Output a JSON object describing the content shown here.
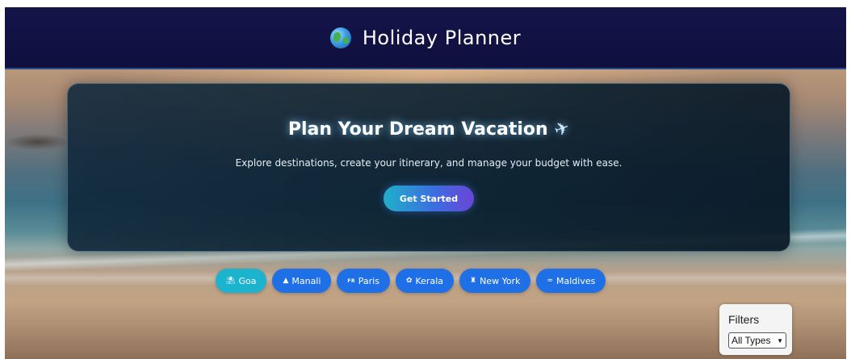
{
  "header": {
    "title": "Holiday Planner",
    "icon": "globe-icon"
  },
  "hero": {
    "title": "Plan Your Dream Vacation",
    "title_icon": "airplane-icon",
    "subtitle": "Explore destinations, create your itinerary, and manage your budget with ease.",
    "cta_label": "Get Started"
  },
  "destinations": [
    {
      "label": "Goa",
      "icon": "beach-umbrella-icon",
      "active": true
    },
    {
      "label": "Manali",
      "icon": "mountain-icon",
      "active": false
    },
    {
      "label": "Paris",
      "icon": "flag-fr-icon",
      "icon_text": "FR",
      "active": false
    },
    {
      "label": "Kerala",
      "icon": "palm-leaf-icon",
      "active": false
    },
    {
      "label": "New York",
      "icon": "statue-of-liberty-icon",
      "active": false
    },
    {
      "label": "Maldives",
      "icon": "wave-icon",
      "active": false
    }
  ],
  "filters": {
    "title": "Filters",
    "selected": "All Types"
  },
  "colors": {
    "header_bg": "#14144a",
    "chip": "#1f6fe6",
    "chip_active": "#1cb3cf"
  }
}
